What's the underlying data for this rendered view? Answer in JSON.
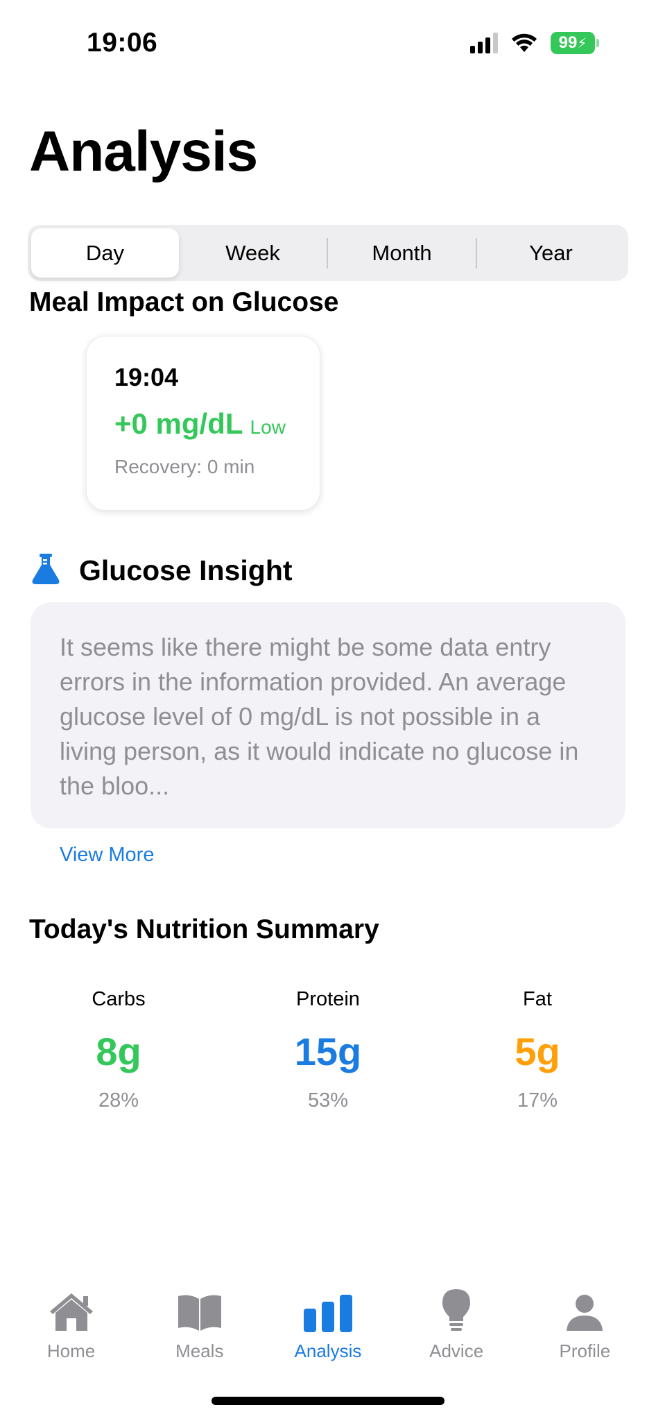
{
  "status_bar": {
    "time": "19:06",
    "battery": "99"
  },
  "page": {
    "title": "Analysis"
  },
  "segments": [
    {
      "label": "Day",
      "selected": true
    },
    {
      "label": "Week",
      "selected": false
    },
    {
      "label": "Month",
      "selected": false
    },
    {
      "label": "Year",
      "selected": false
    }
  ],
  "meal_impact": {
    "title": "Meal Impact on Glucose",
    "card": {
      "time": "19:04",
      "value": "+0 mg/dL",
      "level": "Low",
      "recovery": "Recovery: 0 min"
    }
  },
  "insight": {
    "title": "Glucose Insight",
    "icon": "flask-icon",
    "text": "It seems like there might be some data entry errors in the information provided. An average glucose level of 0 mg/dL is not possible in a living person, as it would indicate no glucose in the bloo...",
    "view_more": "View More"
  },
  "nutrition": {
    "title": "Today's Nutrition Summary",
    "items": [
      {
        "label": "Carbs",
        "value": "8g",
        "percent": "28%",
        "color": "#34c759"
      },
      {
        "label": "Protein",
        "value": "15g",
        "percent": "53%",
        "color": "#1a7be0"
      },
      {
        "label": "Fat",
        "value": "5g",
        "percent": "17%",
        "color": "#ff9f0a"
      }
    ]
  },
  "tab_bar": [
    {
      "label": "Home",
      "icon": "house-icon",
      "active": false
    },
    {
      "label": "Meals",
      "icon": "book-icon",
      "active": false
    },
    {
      "label": "Analysis",
      "icon": "chart-bar-icon",
      "active": true
    },
    {
      "label": "Advice",
      "icon": "lightbulb-icon",
      "active": false
    },
    {
      "label": "Profile",
      "icon": "person-icon",
      "active": false
    }
  ],
  "colors": {
    "accent": "#1a7be0",
    "green": "#34c759",
    "orange": "#ff9f0a",
    "gray": "#8e8e93"
  }
}
